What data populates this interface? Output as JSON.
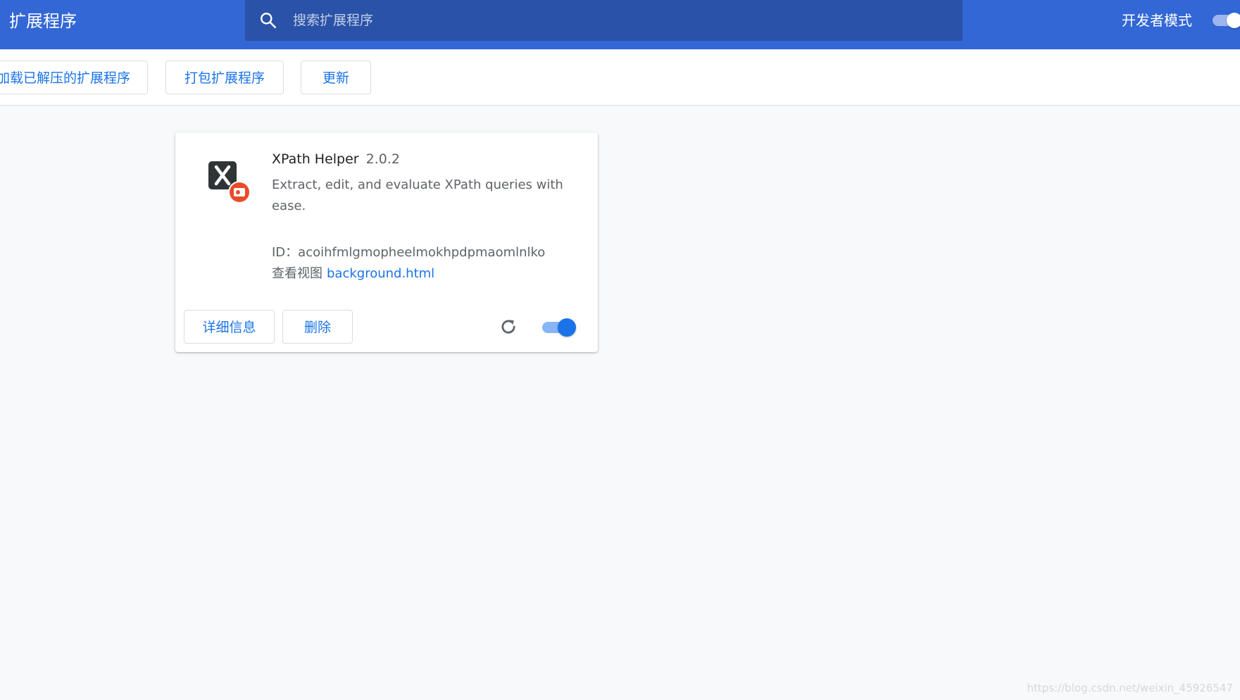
{
  "colors": {
    "header_bg": "#3367d6",
    "search_bg": "#2a52a8",
    "accent": "#1a73e8",
    "page_bg": "#f8f9fa",
    "badge": "#ea4b2a"
  },
  "header": {
    "title": "扩展程序",
    "dev_mode_label": "开发者模式",
    "dev_mode_enabled": true
  },
  "search": {
    "icon": "search-icon",
    "placeholder": "搜索扩展程序",
    "value": ""
  },
  "toolbar": {
    "load_unpacked_label": "加载已解压的扩展程序",
    "pack_label": "打包扩展程序",
    "update_label": "更新"
  },
  "extension": {
    "icon": "xpath-helper-icon",
    "name": "XPath Helper",
    "version": "2.0.2",
    "description": "Extract, edit, and evaluate XPath queries with ease.",
    "id_label": "ID：",
    "id_value": "acoihfmlgmopheelmokhpdpmaomlnlko",
    "views_label": "查看视图",
    "view_link": "background.html",
    "details_label": "详细信息",
    "remove_label": "删除",
    "reload_icon": "reload-icon",
    "enabled": true
  },
  "watermark": "https://blog.csdn.net/weixin_45926547"
}
